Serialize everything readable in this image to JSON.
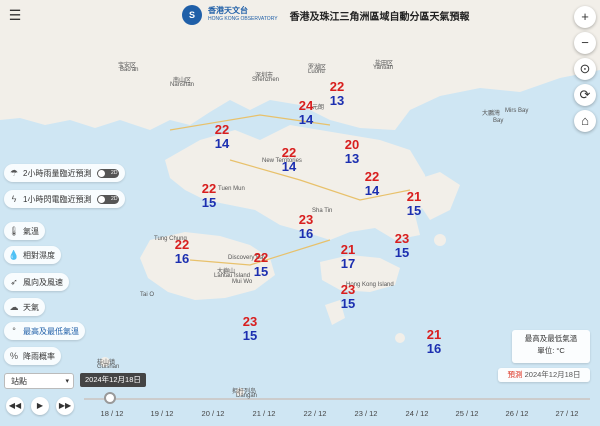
{
  "header": {
    "logo_mark": "S",
    "logo_zh": "香港天文台",
    "logo_en": "HONG KONG OBSERVATORY",
    "title": "香港及珠江三角洲區域自動分區天氣預報"
  },
  "controls": {
    "menu_icon": "menu-icon",
    "zoom_in": "+",
    "zoom_out": "−",
    "locate": "⊙",
    "refresh": "⟳",
    "home": "⌂"
  },
  "sidebar": {
    "items": [
      {
        "label": "2小時雨量臨近預測",
        "toggle": "2D",
        "icon": "rain-icon"
      },
      {
        "label": "1小時閃電臨近預測",
        "toggle": "2D",
        "icon": "lightning-icon"
      },
      {
        "label": "氣溫",
        "icon": "thermometer-icon"
      },
      {
        "label": "相對濕度",
        "icon": "humidity-icon"
      },
      {
        "label": "風向及風速",
        "icon": "wind-icon"
      },
      {
        "label": "天氣",
        "icon": "weather-icon"
      },
      {
        "label": "最高及最低氣溫",
        "icon": "max-min-temp-icon"
      },
      {
        "label": "降雨概率",
        "icon": "percent-icon"
      }
    ],
    "station_select": "站點"
  },
  "legend": {
    "title": "最高及最低氣溫",
    "unit": "單位: °C"
  },
  "forecast": {
    "label": "預測",
    "date": "2024年12月18日"
  },
  "timeline": {
    "current_date": "2024年12月18日",
    "ticks": [
      "18 / 12",
      "19 / 12",
      "20 / 12",
      "21 / 12",
      "22 / 12",
      "23 / 12",
      "24 / 12",
      "25 / 12",
      "26 / 12",
      "27 / 12"
    ]
  },
  "places": [
    "宝安区",
    "Bao'an",
    "南山区",
    "Nanshan",
    "深圳市",
    "Shenzhen",
    "罗湖区",
    "Luohu",
    "盐田区",
    "Yantian",
    "大鵬灣",
    "Mirs Bay",
    "Bay",
    "大嶼山",
    "Lantau Island",
    "Discovery Bay",
    "Mui Wo",
    "Hong Kong Island",
    "Tai O",
    "担杆列岛",
    "Dangan",
    "桂山镇",
    "Guishan",
    "元朗",
    "New Territories",
    "Tuen Mun",
    "Sha Tin",
    "Tung Chung"
  ],
  "stations": [
    {
      "max": "22",
      "min": "13"
    },
    {
      "max": "24",
      "min": "14"
    },
    {
      "max": "22",
      "min": "14"
    },
    {
      "max": "20",
      "min": "13"
    },
    {
      "max": "22",
      "min": "14"
    },
    {
      "max": "22",
      "min": "14"
    },
    {
      "max": "22",
      "min": "15"
    },
    {
      "max": "21",
      "min": "15"
    },
    {
      "max": "23",
      "min": "16"
    },
    {
      "max": "22",
      "min": "16"
    },
    {
      "max": "22",
      "min": "15"
    },
    {
      "max": "21",
      "min": "17"
    },
    {
      "max": "23",
      "min": "15"
    },
    {
      "max": "23",
      "min": "15"
    },
    {
      "max": "23",
      "min": "15"
    },
    {
      "max": "21",
      "min": "16"
    }
  ],
  "colors": {
    "sea": "#cfe6f3",
    "land": "#f2efe9",
    "max_temp": "#d81e1e",
    "min_temp": "#1c2fb0",
    "accent": "#1f5fa8"
  }
}
